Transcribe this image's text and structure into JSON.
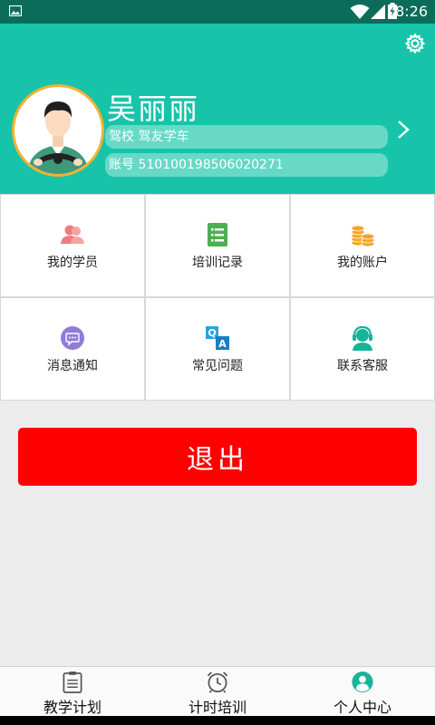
{
  "status_bar": {
    "time": "8:26"
  },
  "profile": {
    "name": "吴丽丽",
    "school_line": "驾校 驾友学车",
    "account_line": "账号 510100198506020271"
  },
  "menu": [
    {
      "label": "我的学员",
      "icon": "students-icon"
    },
    {
      "label": "培训记录",
      "icon": "records-icon"
    },
    {
      "label": "我的账户",
      "icon": "coins-icon"
    },
    {
      "label": "消息通知",
      "icon": "message-icon"
    },
    {
      "label": "常见问题",
      "icon": "qa-icon"
    },
    {
      "label": "联系客服",
      "icon": "customer-service-icon"
    }
  ],
  "logout_label": "退出",
  "bottom_nav": [
    {
      "label": "教学计划",
      "icon": "clipboard-icon"
    },
    {
      "label": "计时培训",
      "icon": "alarm-clock-icon"
    },
    {
      "label": "个人中心",
      "icon": "person-icon"
    }
  ],
  "colors": {
    "primary": "#17c4aa",
    "status_bar": "#0b6c59",
    "logout": "#ff0000",
    "avatar_border": "#f2b231"
  }
}
